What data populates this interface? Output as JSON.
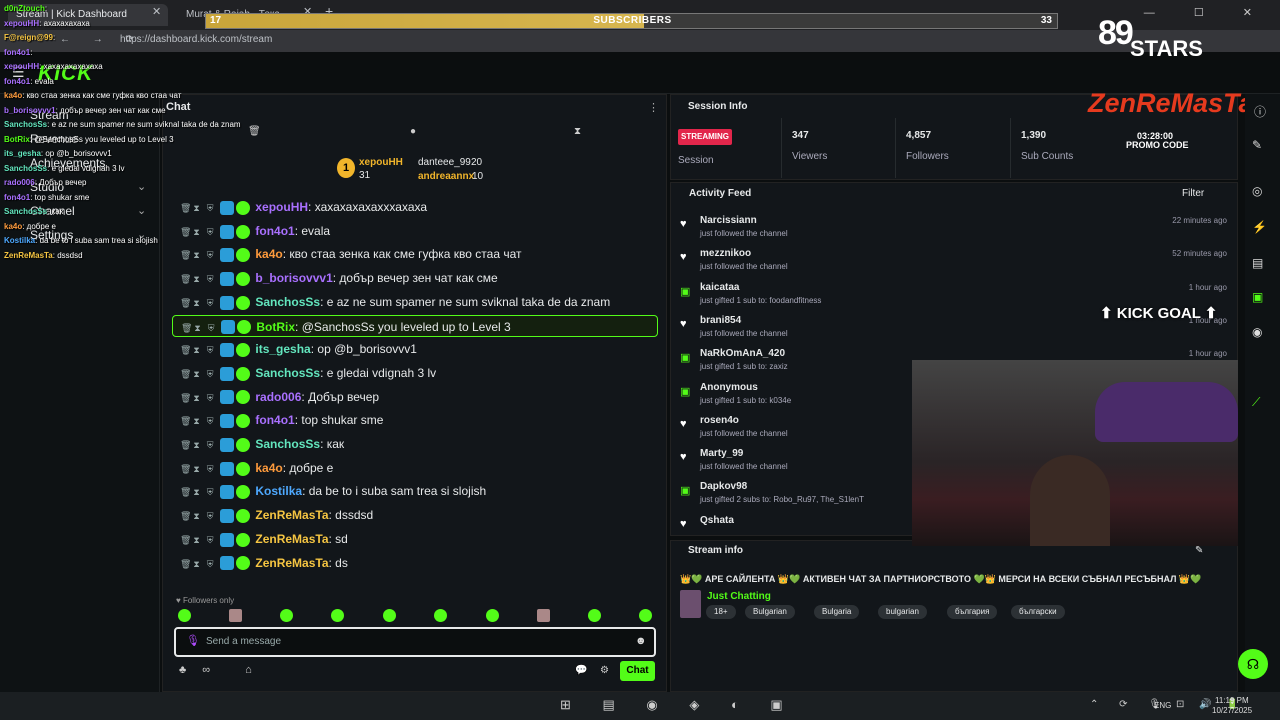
{
  "browser": {
    "tab_active": "Stream | Kick Dashboard",
    "tab_2": "Murat & Rajab - Текс...",
    "url": "https://dashboard.kick.com/stream",
    "tab_close": "✕",
    "new_tab": "+",
    "win_controls": "— ☐ ✕",
    "nav": "← → ⟳"
  },
  "subscribers_bar": {
    "left": "17",
    "title": "SUBSCRIBERS",
    "right": "33",
    "progress": 0.515
  },
  "kick": {
    "logo": "KICK",
    "hamburger": "☰"
  },
  "sidebar": {
    "items": [
      {
        "label": "Stream"
      },
      {
        "label": "Revenue"
      },
      {
        "label": "Achievements"
      },
      {
        "label": "Studio"
      },
      {
        "label": "Channel"
      },
      {
        "label": "Settings"
      }
    ],
    "chevron": "⌄"
  },
  "chat": {
    "title": "Chat",
    "menu": "⋮",
    "pinned": {
      "gift_rank": "1",
      "top_user": "xepouHH",
      "top_count": "31",
      "user_2": "danteee_99",
      "count_2": "20",
      "user_3": "andreaannx",
      "count_3": "10"
    },
    "messages": [
      {
        "user": "xepouHH",
        "text": ": хахахахахахххахаха",
        "color": "#a970ff"
      },
      {
        "user": "fon4o1",
        "text": ": evala",
        "color": "#a970ff"
      },
      {
        "user": "ka4o",
        "text": ": кво стаа зенка как сме гуфка кво стаа чат",
        "color": "#fd9a3c"
      },
      {
        "user": "b_borisovvv1",
        "text": ": добър вечер зен чат как сме",
        "color": "#a970ff"
      },
      {
        "user": "SanchosSs",
        "text": ": e az ne sum spamer ne sum sviknal taka de da znam",
        "color": "#63e6be"
      },
      {
        "user": "BotRix",
        "text": ": @SanchosSs you leveled up to Level 3",
        "color": "#53fc18"
      },
      {
        "user": "its_gesha",
        "text": ": op @b_borisovvv1",
        "color": "#63e6be"
      },
      {
        "user": "SanchosSs",
        "text": ": e gledai vdignah 3 lv",
        "color": "#63e6be"
      },
      {
        "user": "rado006",
        "text": ": Добър вечер",
        "color": "#a970ff"
      },
      {
        "user": "fon4o1",
        "text": ": top shukar sme",
        "color": "#a970ff"
      },
      {
        "user": "SanchosSs",
        "text": ": как",
        "color": "#63e6be"
      },
      {
        "user": "ka4o",
        "text": ": добре е",
        "color": "#fd9a3c"
      },
      {
        "user": "Kostilka",
        "text": ": da be to i suba sam trea si slojish",
        "color": "#4ea9ff"
      },
      {
        "user": "ZenReMasTa",
        "text": ": dssdsd",
        "color": "#f5c542"
      },
      {
        "user": "ZenReMasTa",
        "text": ": sd",
        "color": "#f5c542"
      },
      {
        "user": "ZenReMasTa",
        "text": ": ds",
        "color": "#f5c542"
      }
    ],
    "followers_only": "♥ Followers only",
    "input_placeholder": "Send a message",
    "send_label": "Chat",
    "mic": "🎙",
    "emoji": "☻",
    "gear": "⚙",
    "bubble": "💬",
    "bottom_icons": "♣∞ ⌂"
  },
  "session": {
    "title": "Session Info",
    "status": "STREAMING",
    "status_label": "Session",
    "stats": [
      {
        "value": "347",
        "label": "Viewers"
      },
      {
        "value": "4,857",
        "label": "Followers"
      },
      {
        "value": "1,390",
        "label": "Sub Counts"
      }
    ]
  },
  "activity": {
    "title": "Activity Feed",
    "filter": "Filter",
    "items": [
      {
        "name": "Narcissiann",
        "desc": "just followed the channel",
        "time": "22 minutes ago",
        "icon": "heart-icon"
      },
      {
        "name": "mezznikoo",
        "desc": "just followed the channel",
        "time": "52 minutes ago",
        "icon": "heart-icon"
      },
      {
        "name": "kaicataa",
        "desc": "just gifted 1 sub to: foodandfitness",
        "time": "1 hour ago",
        "icon": "gift-icon"
      },
      {
        "name": "brani854",
        "desc": "just followed the channel",
        "time": "1 hour ago",
        "icon": "heart-icon"
      },
      {
        "name": "NaRkOmAnA_420",
        "desc": "just gifted 1 sub to: zaxiz",
        "time": "1 hour ago",
        "icon": "gift-icon"
      },
      {
        "name": "Anonymous",
        "desc": "just gifted 1 sub to: k034e",
        "time": "",
        "icon": "gift-icon"
      },
      {
        "name": "rosen4o",
        "desc": "just followed the channel",
        "time": "",
        "icon": "heart-icon"
      },
      {
        "name": "Marty_99",
        "desc": "just followed the channel",
        "time": "",
        "icon": "heart-icon"
      },
      {
        "name": "Dapkov98",
        "desc": "just gifted 2 subs to: Robo_Ru97, The_S1lenT",
        "time": "",
        "icon": "gift-icon"
      },
      {
        "name": "Qshata",
        "desc": "",
        "time": "",
        "icon": "heart-icon"
      }
    ]
  },
  "stream_info": {
    "title": "Stream info",
    "stream_title": "👑💚 АРЕ САЙЛЕНТА 👑💚 АКТИВЕН ЧАТ ЗА ПАРТНИОРСТВОТО 💚👑 МЕРСИ НА ВСЕКИ СЪБНАЛ РЕСЪБНАЛ 👑💚",
    "category": "Just Chatting",
    "tags": [
      "18+",
      "Bulgarian",
      "Bulgaria",
      "bulgarian",
      "българия",
      "български"
    ]
  },
  "overlay": {
    "brand_89": "89",
    "stars": "STARS",
    "streamer": "ZenReMasTa",
    "time": "03:28:00",
    "promo": "PROMO CODE",
    "goal": "⬆ KICK GOAL ⬆"
  },
  "overlay_chat": [
    {
      "n": "d0nZtouch",
      "t": ":"
    },
    {
      "n": "xepouHH",
      "t": ": ахахахахаха"
    },
    {
      "n": "F@reign@99",
      "t": ":"
    },
    {
      "n": "fon4o1",
      "t": ":"
    },
    {
      "n": "xepouHH",
      "t": ": xaxaxaxaxaxaxa"
    },
    {
      "n": "fon4o1",
      "t": ": evala"
    },
    {
      "n": "ka4o",
      "t": ": кво стаа зенка как сме гуфка кво стаа чат"
    },
    {
      "n": "b_borisovvv1",
      "t": ": добър вечер зен чат как сме"
    },
    {
      "n": "SanchosSs",
      "t": ": e az ne sum spamer ne sum sviknal taka de da znam"
    },
    {
      "n": "BotRix",
      "t": ": @SanchosSs you leveled up to Level 3"
    },
    {
      "n": "its_gesha",
      "t": ": op @b_borisovvv1"
    },
    {
      "n": "SanchosSs",
      "t": ": e gledai vdignah 3 lv"
    },
    {
      "n": "rado006",
      "t": ": Добър вечер"
    },
    {
      "n": "fon4o1",
      "t": ": top shukar sme"
    },
    {
      "n": "SanchosSs",
      "t": ": как"
    },
    {
      "n": "ka4o",
      "t": ": добре е"
    },
    {
      "n": "Kostilka",
      "t": ": da be to i suba sam trea si slojish"
    },
    {
      "n": "ZenReMasTa",
      "t": ": dssdsd"
    }
  ],
  "taskbar": {
    "lang": "ENG",
    "time": "11:19 PM",
    "date": "10/27/2025",
    "apps": "⊞ ▤ ◉ ◈ ◐ ▣",
    "tray": "⌃ ⟳ 🎙",
    "tray2": "⊡ 🔊 🔋"
  },
  "colors": {
    "accent": "#53fc18",
    "live": "#e2264b"
  }
}
